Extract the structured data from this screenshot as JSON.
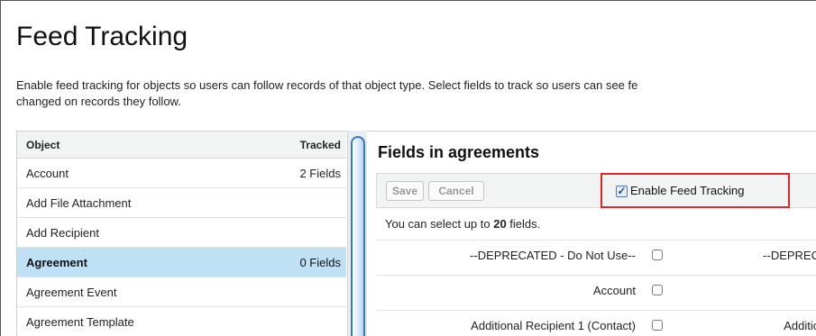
{
  "page": {
    "title": "Feed Tracking",
    "description_line1": "Enable feed tracking for objects so users can follow records of that object type. Select fields to track so users can see fe",
    "description_line2": "changed on records they follow."
  },
  "objects": {
    "header_object": "Object",
    "header_tracked": "Tracked",
    "rows": [
      {
        "name": "Account",
        "tracked": "2 Fields",
        "selected": false
      },
      {
        "name": "Add File Attachment",
        "tracked": "",
        "selected": false
      },
      {
        "name": "Add Recipient",
        "tracked": "",
        "selected": false
      },
      {
        "name": "Agreement",
        "tracked": "0 Fields",
        "selected": true
      },
      {
        "name": "Agreement Event",
        "tracked": "",
        "selected": false
      },
      {
        "name": "Agreement Template",
        "tracked": "",
        "selected": false
      }
    ]
  },
  "fields_panel": {
    "title": "Fields in agreements",
    "save_label": "Save",
    "cancel_label": "Cancel",
    "enable_label": "Enable Feed Tracking",
    "enable_checked": true,
    "note_prefix": "You can select up to ",
    "note_count": "20",
    "note_suffix": " fields.",
    "fields": [
      {
        "label": "--DEPRECATED - Do Not Use--",
        "label2": "--DEPREC"
      },
      {
        "label": "Account",
        "label2": ""
      },
      {
        "label": "Additional Recipient 1 (Contact)",
        "label2": "Additio"
      }
    ]
  },
  "colors": {
    "selected_row": "#bfe0f5",
    "highlight_border": "#e8262a",
    "scroll_accent": "#2f7bd0"
  }
}
